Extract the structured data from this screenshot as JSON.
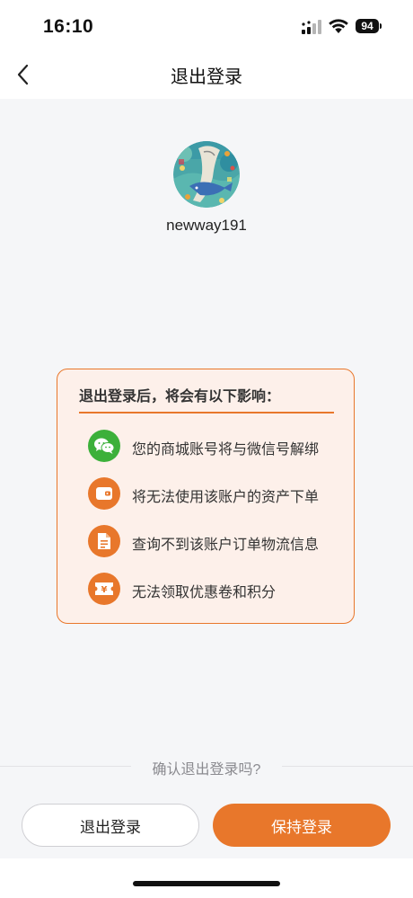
{
  "status_bar": {
    "time": "16:10",
    "battery": "94"
  },
  "nav": {
    "title": "退出登录",
    "back_icon": "chevron-left-icon"
  },
  "profile": {
    "username": "newway191"
  },
  "impact_card": {
    "title": "退出登录后，将会有以下影响：",
    "accent_color": "#e8772b",
    "items": [
      {
        "icon": "wechat-icon",
        "color": "#3cb03a",
        "text": "您的商城账号将与微信号解绑"
      },
      {
        "icon": "wallet-icon",
        "color": "#e8772b",
        "text": "将无法使用该账户的资产下单"
      },
      {
        "icon": "document-icon",
        "color": "#e8772b",
        "text": "查询不到该账户订单物流信息"
      },
      {
        "icon": "coupon-icon",
        "color": "#e8772b",
        "text": "无法领取优惠卷和积分"
      }
    ]
  },
  "footer": {
    "confirm_text": "确认退出登录吗?",
    "logout_label": "退出登录",
    "stay_label": "保持登录"
  }
}
